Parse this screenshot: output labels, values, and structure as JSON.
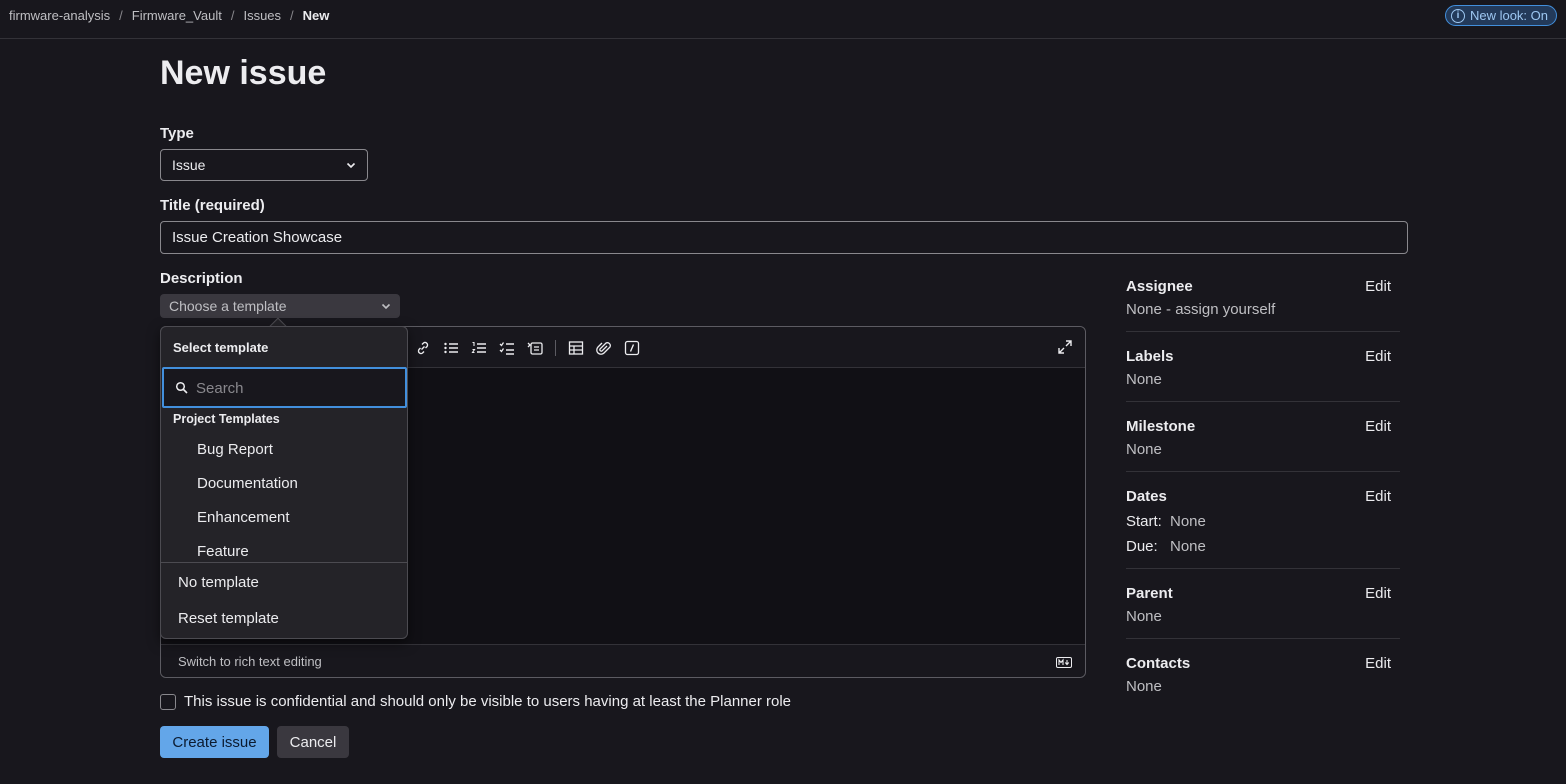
{
  "breadcrumb": {
    "items": [
      "firmware-analysis",
      "Firmware_Vault",
      "Issues"
    ],
    "current": "New",
    "separator": "/"
  },
  "new_look": {
    "label": "New look: On",
    "icon": "info-icon"
  },
  "page": {
    "title": "New issue"
  },
  "form": {
    "type_label": "Type",
    "type_value": "Issue",
    "title_label": "Title (required)",
    "title_value": "Issue Creation Showcase",
    "description_label": "Description",
    "template_button": "Choose a template",
    "switch_rich": "Switch to rich text editing",
    "confidential_label": "This issue is confidential and should only be visible to users having at least the Planner role",
    "create_button": "Create issue",
    "cancel_button": "Cancel"
  },
  "template_dropdown": {
    "header": "Select template",
    "search_placeholder": "Search",
    "group_label": "Project Templates",
    "items": [
      "Bug Report",
      "Documentation",
      "Enhancement",
      "Feature"
    ],
    "actions": [
      "No template",
      "Reset template"
    ]
  },
  "sidebar": {
    "edit_label": "Edit",
    "assignee": {
      "title": "Assignee",
      "value": "None - assign yourself"
    },
    "labels": {
      "title": "Labels",
      "value": "None"
    },
    "milestone": {
      "title": "Milestone",
      "value": "None"
    },
    "dates": {
      "title": "Dates",
      "start_label": "Start:",
      "start_value": "None",
      "due_label": "Due:",
      "due_value": "None"
    },
    "parent": {
      "title": "Parent",
      "value": "None"
    },
    "contacts": {
      "title": "Contacts",
      "value": "None"
    }
  },
  "colors": {
    "accent": "#428fdc",
    "primary_button": "#63a6e9",
    "background": "#18171d"
  }
}
